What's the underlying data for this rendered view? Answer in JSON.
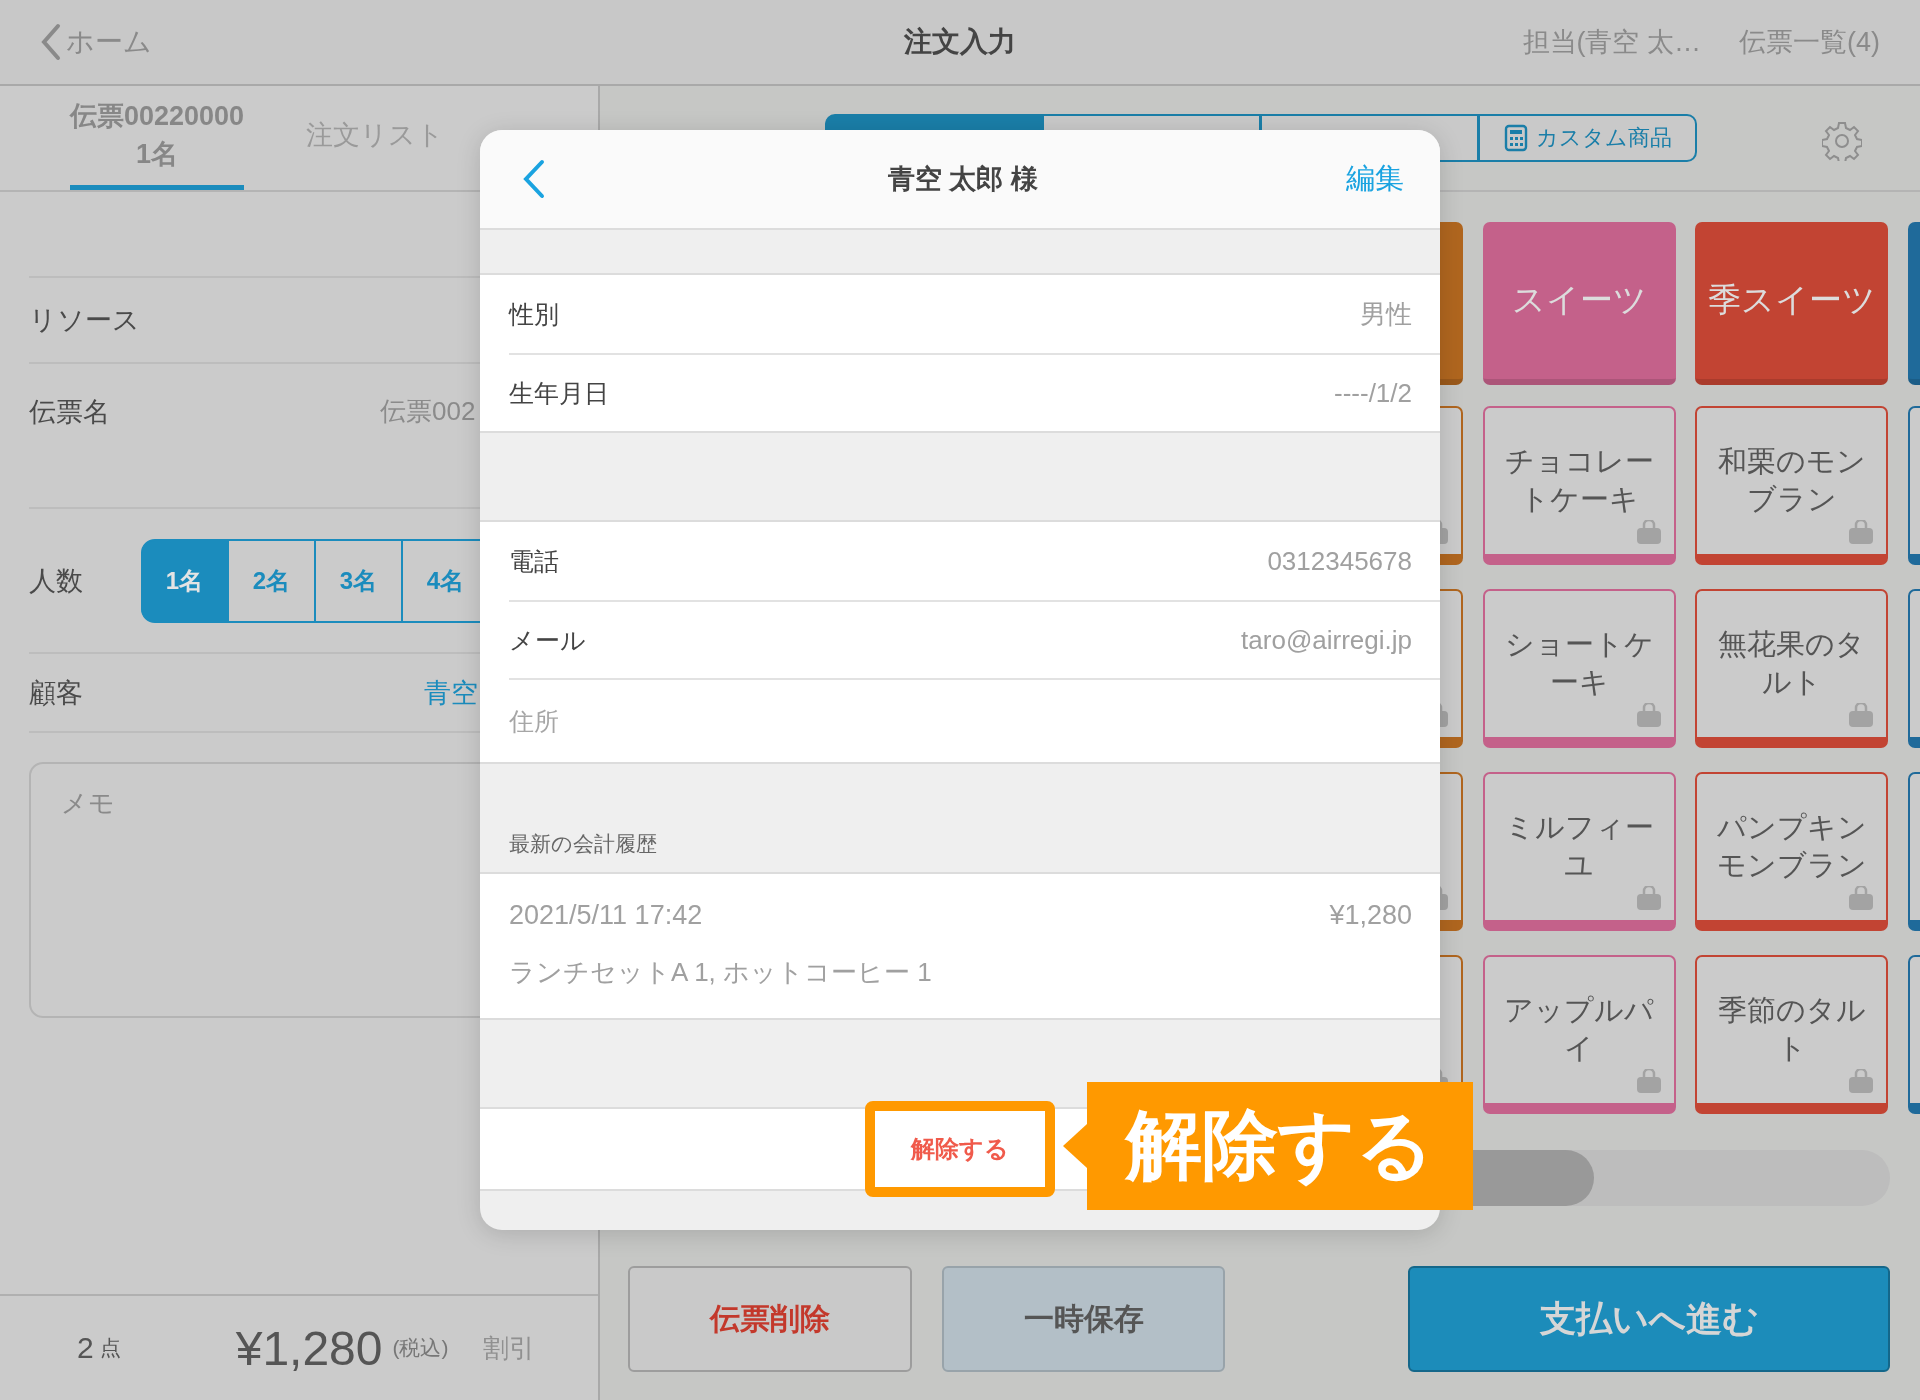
{
  "header": {
    "back": "ホーム",
    "title": "注文入力",
    "staff": "担当(青空 太…",
    "slips": "伝票一覧(4)"
  },
  "slip_tabs": [
    {
      "label": "伝票00220000",
      "sub": "1名",
      "selected": true
    },
    {
      "label": "注文リスト",
      "selected": false
    }
  ],
  "fields": [
    {
      "kind": "plain",
      "label": "リソース"
    },
    {
      "kind": "value",
      "label": "伝票名",
      "value": "伝票002"
    },
    {
      "kind": "segments",
      "label": "人数",
      "options": [
        {
          "label": "1名",
          "selected": true
        },
        {
          "label": "2名",
          "selected": false
        },
        {
          "label": "3名",
          "selected": false
        },
        {
          "label": "4名",
          "selected": false
        }
      ]
    },
    {
      "kind": "link",
      "label": "顧客",
      "value": "青空"
    }
  ],
  "memo": {
    "placeholder": "メモ"
  },
  "summary": {
    "count": "2",
    "count_unit": "点",
    "total": "¥1,280",
    "tax_note": "(税込)",
    "discount": "割引"
  },
  "category_tabs": [
    {
      "selected": true
    },
    {
      "selected": false
    },
    {
      "selected": false
    },
    {
      "label": "カスタム商品",
      "selected": false
    }
  ],
  "product_columns": [
    {
      "color": "#b0661f"
    },
    {
      "color": "#c4618a",
      "category": "スイーツ",
      "items": [
        "チョコレートケーキ",
        "ショートケーキ",
        "ミルフィーユ",
        "アップルパイ"
      ]
    },
    {
      "color": "#c24433",
      "category": "季スイーツ",
      "items": [
        "和栗のモンブラン",
        "無花果のタルト",
        "パンプキンモンブラン",
        "季節のタルト"
      ]
    },
    {
      "color": "#1f6a9a"
    }
  ],
  "actions": [
    {
      "kind": "danger",
      "label": "伝票削除"
    },
    {
      "kind": "neutral",
      "label": "一時保存"
    },
    {
      "kind": "primary",
      "label": "支払いへ進む"
    }
  ],
  "modal": {
    "title": "青空 太郎 様",
    "edit": "編集",
    "groups": [
      [
        {
          "label": "性別",
          "value": "男性"
        },
        {
          "label": "生年月日",
          "value": "----/1/2"
        }
      ],
      [
        {
          "label": "電話",
          "value": "0312345678"
        },
        {
          "label": "メール",
          "value": "taro@airregi.jp"
        },
        {
          "label": "住所"
        }
      ]
    ],
    "history": {
      "heading": "最新の会計履歴",
      "date": "2021/5/11 17:42",
      "amount": "¥1,280",
      "items": "ランチセットA 1, ホットコーヒー 1"
    },
    "release": "解除する"
  },
  "callout": {
    "text": "解除する"
  }
}
